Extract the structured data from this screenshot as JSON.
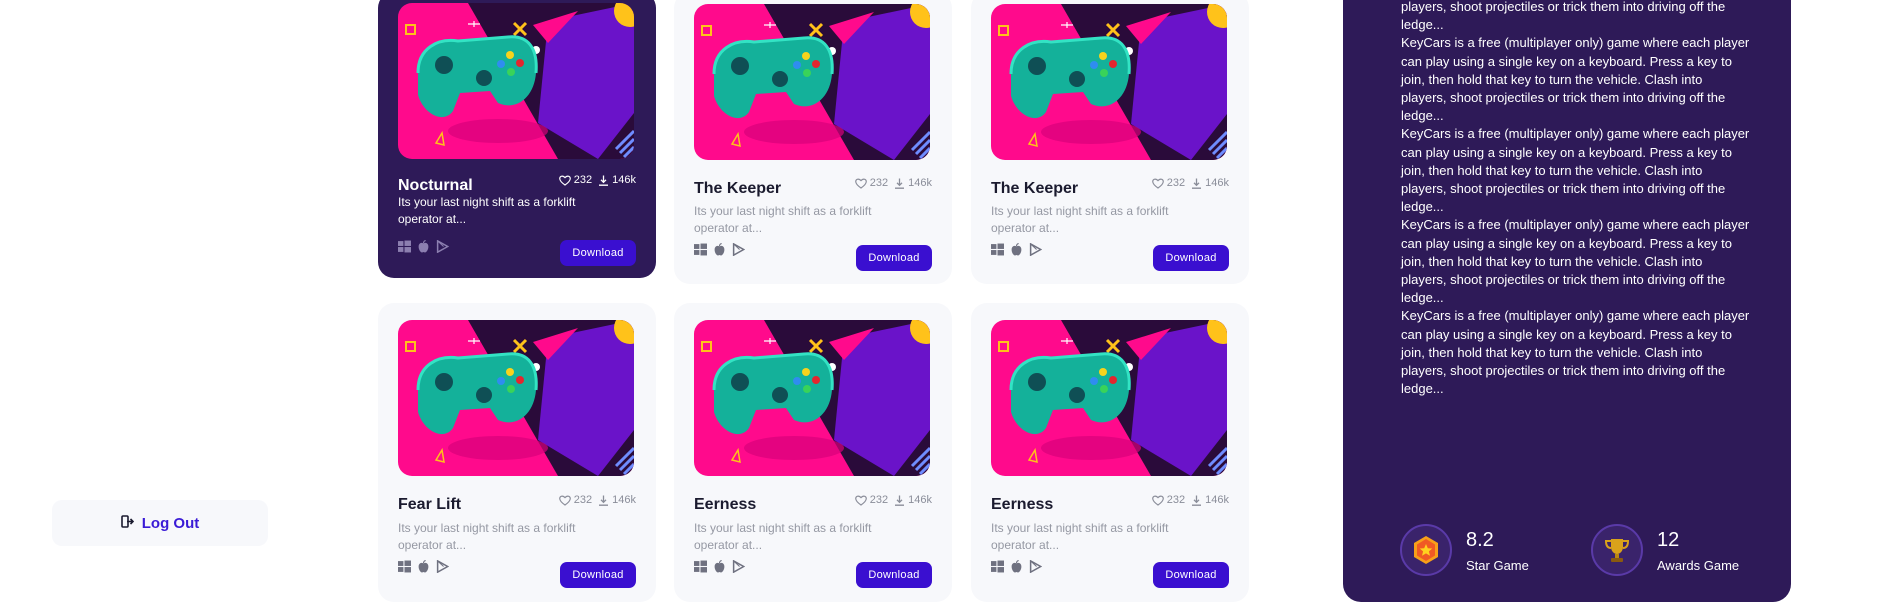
{
  "sidebar": {
    "logout_label": "Log Out"
  },
  "games": [
    {
      "title": "Nocturnal",
      "likes": "232",
      "downloads": "146k",
      "description": "Its your last night shift as a forklift operator at...",
      "download_label": "Download",
      "active": true
    },
    {
      "title": "The Keeper",
      "likes": "232",
      "downloads": "146k",
      "description": "Its your last night shift as a forklift operator at...",
      "download_label": "Download",
      "active": false
    },
    {
      "title": "The Keeper",
      "likes": "232",
      "downloads": "146k",
      "description": "Its your last night shift as a forklift operator at...",
      "download_label": "Download",
      "active": false
    },
    {
      "title": "Fear Lift",
      "likes": "232",
      "downloads": "146k",
      "description": "Its your last night shift as a forklift operator at...",
      "download_label": "Download",
      "active": false
    },
    {
      "title": "Eerness",
      "likes": "232",
      "downloads": "146k",
      "description": "Its your last night shift as a forklift operator at...",
      "download_label": "Download",
      "active": false
    },
    {
      "title": "Eerness",
      "likes": "232",
      "downloads": "146k",
      "description": "Its your last night shift as a forklift operator at...",
      "download_label": "Download",
      "active": false
    }
  ],
  "detail": {
    "description_lines": [
      "players, shoot projectiles or trick them into driving off the ledge...",
      "KeyCars is a free (multiplayer only) game where each player can play using a single key on a keyboard. Press a key to join, then hold that key to turn the vehicle. Clash into players, shoot projectiles or trick them into driving off the ledge...",
      "KeyCars is a free (multiplayer only) game where each player can play using a single key on a keyboard. Press a key to join, then hold that key to turn the vehicle. Clash into players, shoot projectiles or trick them into driving off the ledge...",
      "KeyCars is a free (multiplayer only) game where each player can play using a single key on a keyboard. Press a key to join, then hold that key to turn the vehicle. Clash into players, shoot projectiles or trick them into driving off the ledge...",
      "KeyCars is a free (multiplayer only) game where each player can play using a single key on a keyboard. Press a key to join, then hold that key to turn the vehicle. Clash into players, shoot projectiles or trick them into driving off the ledge..."
    ],
    "star_value": "8.2",
    "star_label": "Star Game",
    "awards_value": "12",
    "awards_label": "Awards Game"
  },
  "colors": {
    "accent": "#3a0fd0",
    "panel": "#2e1a58",
    "thumb_pink": "#ff0a8c",
    "thumb_purple": "#6a13c9"
  },
  "icons": [
    "logout-icon",
    "heart-icon",
    "download-icon",
    "windows-icon",
    "apple-icon",
    "play-store-icon",
    "shield-star-icon",
    "trophy-icon",
    "gamepad-art"
  ]
}
